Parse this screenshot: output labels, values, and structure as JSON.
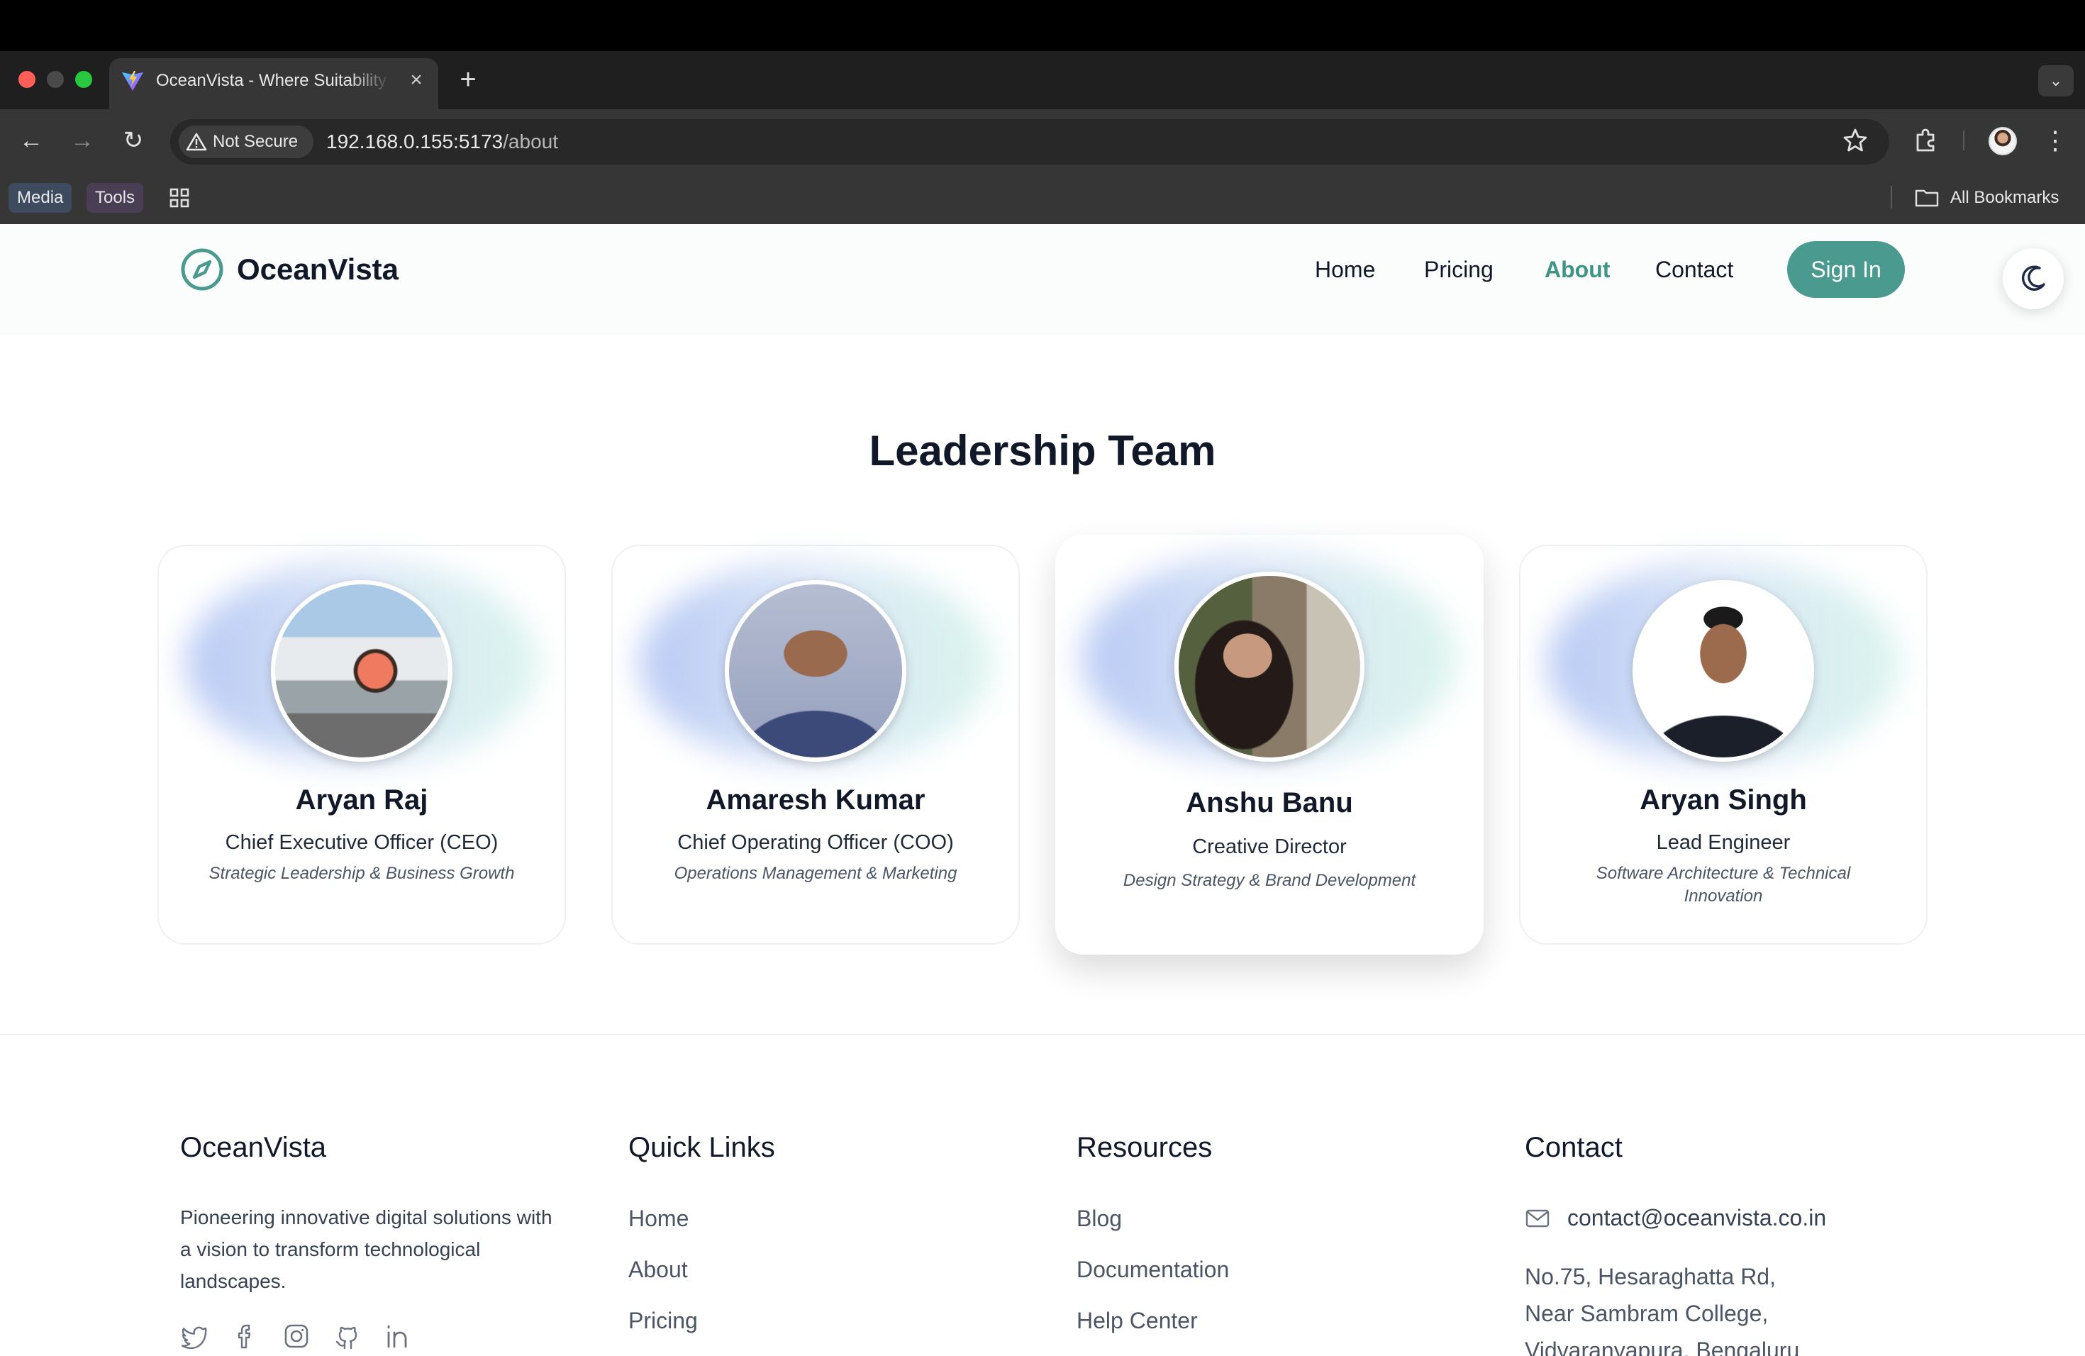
{
  "browser": {
    "tab_title": "OceanVista - Where Suitability Meets Vision",
    "new_tab_symbol": "+",
    "security_label": "Not Secure",
    "url_host": "192.168.0.155:5173",
    "url_path": "/about",
    "bookmarks": [
      "Media",
      "Tools"
    ],
    "all_bookmarks_label": "All Bookmarks"
  },
  "site": {
    "brand": "OceanVista",
    "brand_color": "#4a9a8f",
    "nav": [
      "Home",
      "Pricing",
      "About",
      "Contact"
    ],
    "active_nav": "About",
    "signin_label": "Sign In"
  },
  "team": {
    "title": "Leadership Team",
    "members": [
      {
        "name": "Aryan Raj",
        "role": "Chief Executive Officer (CEO)",
        "focus": "Strategic Leadership & Business Growth"
      },
      {
        "name": "Amaresh Kumar",
        "role": "Chief Operating Officer (COO)",
        "focus": "Operations Management & Marketing"
      },
      {
        "name": "Anshu Banu",
        "role": "Creative Director",
        "focus": "Design Strategy & Brand Development"
      },
      {
        "name": "Aryan Singh",
        "role": "Lead Engineer",
        "focus": "Software Architecture & Technical Innovation"
      }
    ]
  },
  "footer": {
    "brand": "OceanVista",
    "about": "Pioneering innovative digital solutions with a vision to transform technological landscapes.",
    "social_icons": [
      "twitter-icon",
      "facebook-icon",
      "instagram-icon",
      "github-icon",
      "linkedin-icon"
    ],
    "quick_links_title": "Quick Links",
    "quick_links": [
      "Home",
      "About",
      "Pricing"
    ],
    "resources_title": "Resources",
    "resources": [
      "Blog",
      "Documentation",
      "Help Center"
    ],
    "contact_title": "Contact",
    "email": "contact@oceanvista.co.in",
    "address_lines": [
      "No.75, Hesaraghatta Rd,",
      "Near Sambram College,",
      "Vidyaranyapura, Bengaluru"
    ]
  }
}
